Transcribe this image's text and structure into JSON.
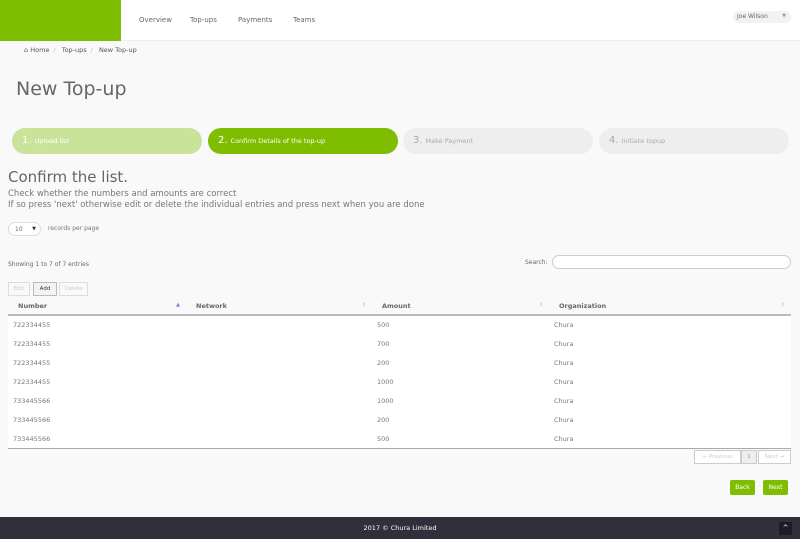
{
  "nav": {
    "items": [
      "Overview",
      "Top-ups",
      "Payments",
      "Teams"
    ],
    "user": "Joe Wilson"
  },
  "breadcrumb": [
    "Home",
    "Top-ups",
    "New Top-up"
  ],
  "page_title": "New Top-up",
  "steps": [
    {
      "num": "1.",
      "label": "Upload list",
      "state": "done"
    },
    {
      "num": "2.",
      "label": "Confirm Details of the top-up",
      "state": "active"
    },
    {
      "num": "3.",
      "label": "Make Payment",
      "state": "pending"
    },
    {
      "num": "4.",
      "label": "Initiate topup",
      "state": "pending"
    }
  ],
  "section_title": "Confirm the list.",
  "desc1": "Check whether the numbers and amounts are correct",
  "desc2": "If so press 'next' otherwise edit or delete the individual entries and press next when you are done",
  "length": {
    "value": "10",
    "label": "records per page"
  },
  "info": "Showing 1 to 7 of 7 entries",
  "search_label": "Search:",
  "buttons": {
    "edit": "Edit",
    "add": "Add",
    "delete": "Delete"
  },
  "columns": [
    "Number",
    "Network",
    "Amount",
    "Organization"
  ],
  "rows": [
    [
      "722334455",
      "",
      "500",
      "Chura"
    ],
    [
      "722334455",
      "",
      "700",
      "Chura"
    ],
    [
      "722334455",
      "",
      "200",
      "Chura"
    ],
    [
      "722334455",
      "",
      "1000",
      "Chura"
    ],
    [
      "733445566",
      "",
      "1000",
      "Chura"
    ],
    [
      "733445566",
      "",
      "200",
      "Chura"
    ],
    [
      "733445566",
      "",
      "500",
      "Chura"
    ]
  ],
  "pagination": {
    "previous": "← Previous",
    "page": "1",
    "next": "Next →"
  },
  "actions": {
    "back": "Back",
    "next": "Next"
  },
  "footer": "2017 © Chura Limited",
  "colors": {
    "accent": "#7fbd00",
    "footer": "#30303a"
  }
}
